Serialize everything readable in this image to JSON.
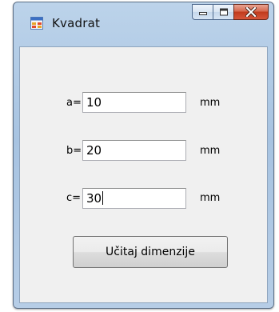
{
  "window": {
    "title": "Kvadrat"
  },
  "form": {
    "fields": [
      {
        "label": "a=",
        "value": "10",
        "unit": "mm"
      },
      {
        "label": "b=",
        "value": "20",
        "unit": "mm"
      },
      {
        "label": "c=",
        "value": "30",
        "unit": "mm"
      }
    ],
    "button_label": "Učitaj dimenzije"
  },
  "icons": {
    "app": "form-app-icon",
    "minimize": "minimize-icon",
    "maximize": "maximize-icon",
    "close": "close-icon"
  },
  "colors": {
    "titlebar": "#a7c3e1",
    "client": "#f0f0f0",
    "close_button": "#c13b1c"
  }
}
